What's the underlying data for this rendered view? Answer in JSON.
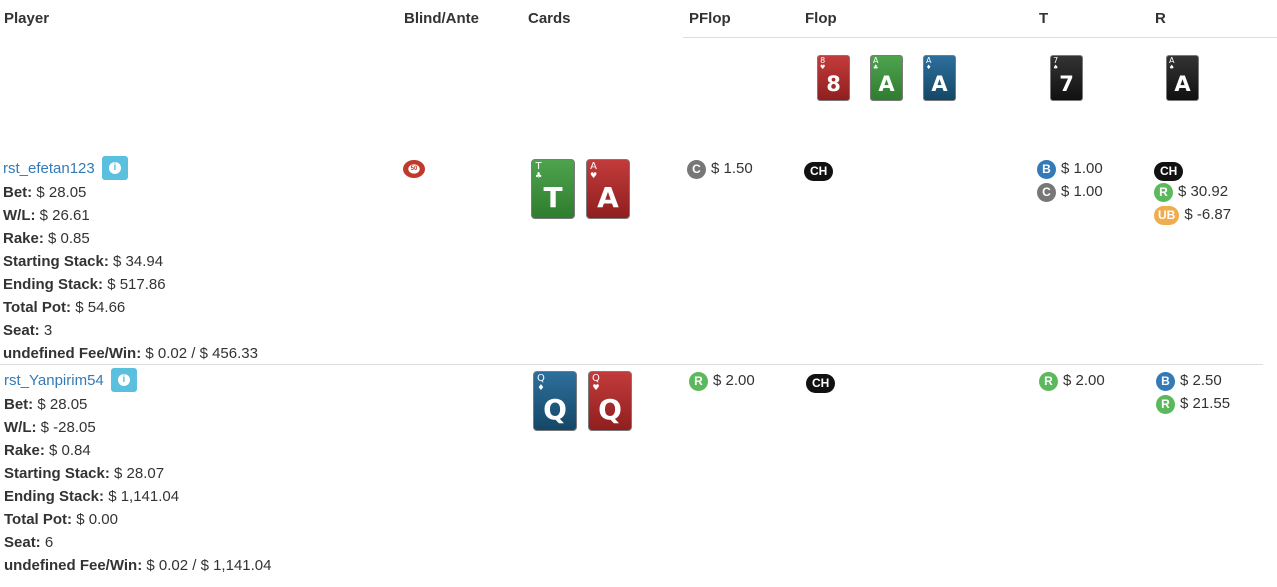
{
  "headers": {
    "player": "Player",
    "blind_ante": "Blind/Ante",
    "cards": "Cards",
    "pflop": "PFlop",
    "flop": "Flop",
    "turn": "T",
    "river": "R"
  },
  "board": {
    "flop": [
      {
        "rank": "8",
        "corner": "8",
        "suit": "hearts",
        "color": "red"
      },
      {
        "rank": "A",
        "corner": "A",
        "suit": "clubs",
        "color": "green"
      },
      {
        "rank": "A",
        "corner": "A",
        "suit": "diamonds",
        "color": "blue"
      }
    ],
    "turn": {
      "rank": "7",
      "corner": "7",
      "suit": "spades",
      "color": "black"
    },
    "river": {
      "rank": "A",
      "corner": "A",
      "suit": "spades",
      "color": "black"
    }
  },
  "labels": {
    "bet": "Bet:",
    "wl": "W/L:",
    "rake": "Rake:",
    "starting_stack": "Starting Stack:",
    "ending_stack": "Ending Stack:",
    "total_pot": "Total Pot:",
    "seat": "Seat:",
    "fee_win": "undefined Fee/Win:"
  },
  "players": [
    {
      "name": "rst_efetan123",
      "bet": "$ 28.05",
      "wl": "$ 26.61",
      "rake": "$ 0.85",
      "starting_stack": "$ 34.94",
      "ending_stack": "$ 517.86",
      "total_pot": "$ 54.66",
      "seat": "3",
      "fee_win": "$ 0.02 / $ 456.33",
      "blind_chip": "50",
      "cards": [
        {
          "rank": "T",
          "corner": "T",
          "suit": "clubs",
          "color": "green"
        },
        {
          "rank": "A",
          "corner": "A",
          "suit": "hearts",
          "color": "red"
        }
      ],
      "pflop": [
        {
          "badge": "C",
          "amount": "$ 1.50"
        }
      ],
      "flop": [
        {
          "badge": "CH",
          "amount": ""
        }
      ],
      "turn": [
        {
          "badge": "B",
          "amount": "$ 1.00"
        },
        {
          "badge": "C",
          "amount": "$ 1.00"
        }
      ],
      "river": [
        {
          "badge": "CH",
          "amount": ""
        },
        {
          "badge": "R",
          "amount": "$ 30.92"
        },
        {
          "badge": "UB",
          "amount": "$ -6.87"
        }
      ]
    },
    {
      "name": "rst_Yanpirim54",
      "bet": "$ 28.05",
      "wl": "$ -28.05",
      "rake": "$ 0.84",
      "starting_stack": "$ 28.07",
      "ending_stack": "$ 1,141.04",
      "total_pot": "$ 0.00",
      "seat": "6",
      "fee_win": "$ 0.02 / $ 1,141.04",
      "cards": [
        {
          "rank": "Q",
          "corner": "Q",
          "suit": "diamonds",
          "color": "blue"
        },
        {
          "rank": "Q",
          "corner": "Q",
          "suit": "hearts",
          "color": "red"
        }
      ],
      "pflop": [
        {
          "badge": "R",
          "amount": "$ 2.00"
        }
      ],
      "flop": [
        {
          "badge": "CH",
          "amount": ""
        }
      ],
      "turn": [
        {
          "badge": "R",
          "amount": "$ 2.00"
        }
      ],
      "river": [
        {
          "badge": "B",
          "amount": "$ 2.50"
        },
        {
          "badge": "R",
          "amount": "$ 21.55"
        }
      ]
    }
  ],
  "badge_colors": {
    "C": "#777777",
    "CH": "#111111",
    "B": "#337ab7",
    "R": "#5cb85c",
    "UB": "#f0ad4e"
  }
}
